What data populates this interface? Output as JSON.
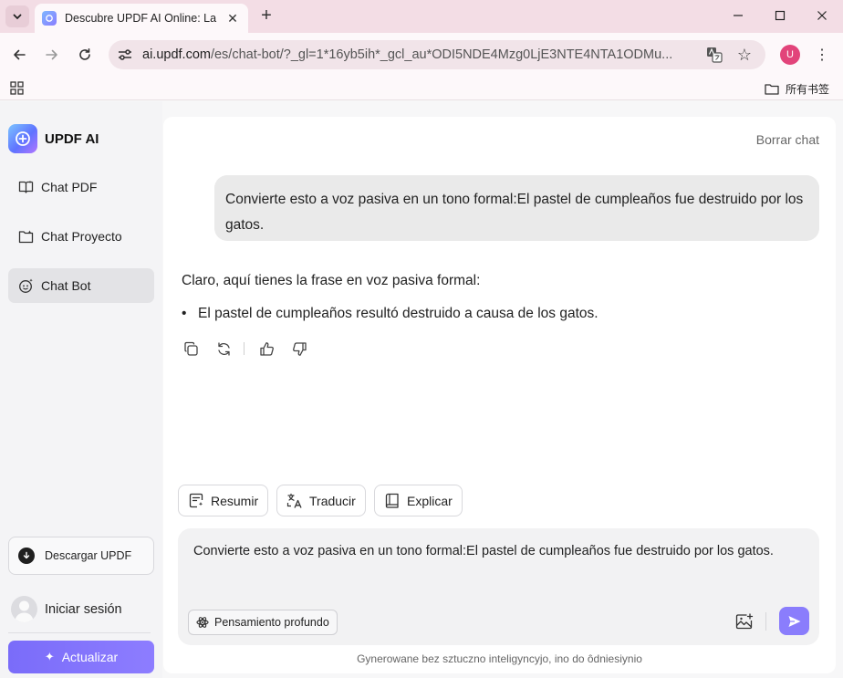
{
  "browser": {
    "tab_title": "Descubre UPDF AI Online: La",
    "url_host": "ai.updf.com",
    "url_path": "/es/chat-bot/?_gl=1*16yb5ih*_gcl_au*ODI5NDE4Mzg0LjE3NTE4NTA1ODMu...",
    "profile_initial": "U",
    "bookmarks_folder": "所有书签"
  },
  "sidebar": {
    "brand": "UPDF AI",
    "items": [
      {
        "label": "Chat PDF",
        "icon": "book-icon"
      },
      {
        "label": "Chat Proyecto",
        "icon": "folder-icon"
      },
      {
        "label": "Chat Bot",
        "icon": "bot-icon",
        "active": true
      }
    ],
    "download_label": "Descargar UPDF",
    "login_label": "Iniciar sesión",
    "upgrade_label": "Actualizar"
  },
  "chat": {
    "clear_label": "Borrar chat",
    "user_message": "Convierte esto a voz pasiva en un tono formal:El pastel de cumpleaños fue destruido por los gatos.",
    "bot_intro": "Claro, aquí tienes la frase en voz pasiva formal:",
    "bot_bullets": [
      "El pastel de cumpleaños resultó destruido a causa de los gatos."
    ]
  },
  "quick_actions": {
    "summarize": "Resumir",
    "translate": "Traducir",
    "explain": "Explicar"
  },
  "composer": {
    "value": "Convierte esto a voz pasiva en un tono formal:El pastel de cumpleaños fue destruido por los gatos.",
    "deep_thinking_label": "Pensamiento profundo"
  },
  "footer_note": "Gynerowane bez sztuczno inteligyncyjo, ino do ôdniesiynio",
  "colors": {
    "accent": "#8a7dfc",
    "tabbar": "#f3dde5",
    "profile": "#e2447a"
  }
}
